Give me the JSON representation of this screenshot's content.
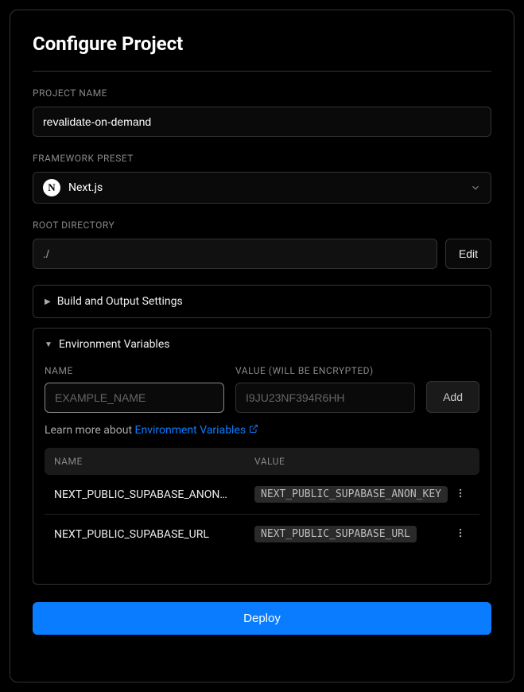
{
  "title": "Configure Project",
  "projectName": {
    "label": "PROJECT NAME",
    "value": "revalidate-on-demand"
  },
  "framework": {
    "label": "FRAMEWORK PRESET",
    "iconLetter": "N",
    "value": "Next.js"
  },
  "rootDir": {
    "label": "ROOT DIRECTORY",
    "value": "./",
    "editLabel": "Edit"
  },
  "buildSection": {
    "label": "Build and Output Settings"
  },
  "envSection": {
    "label": "Environment Variables",
    "nameLabel": "NAME",
    "valueLabel": "VALUE (WILL BE ENCRYPTED)",
    "namePlaceholder": "EXAMPLE_NAME",
    "valuePlaceholder": "I9JU23NF394R6HH",
    "addLabel": "Add",
    "learnPrefix": "Learn more about ",
    "learnLink": "Environment Variables",
    "tableHeaders": {
      "name": "NAME",
      "value": "VALUE"
    },
    "rows": [
      {
        "name": "NEXT_PUBLIC_SUPABASE_ANON…",
        "value": "NEXT_PUBLIC_SUPABASE_ANON_KEY"
      },
      {
        "name": "NEXT_PUBLIC_SUPABASE_URL",
        "value": "NEXT_PUBLIC_SUPABASE_URL"
      }
    ]
  },
  "deployLabel": "Deploy"
}
